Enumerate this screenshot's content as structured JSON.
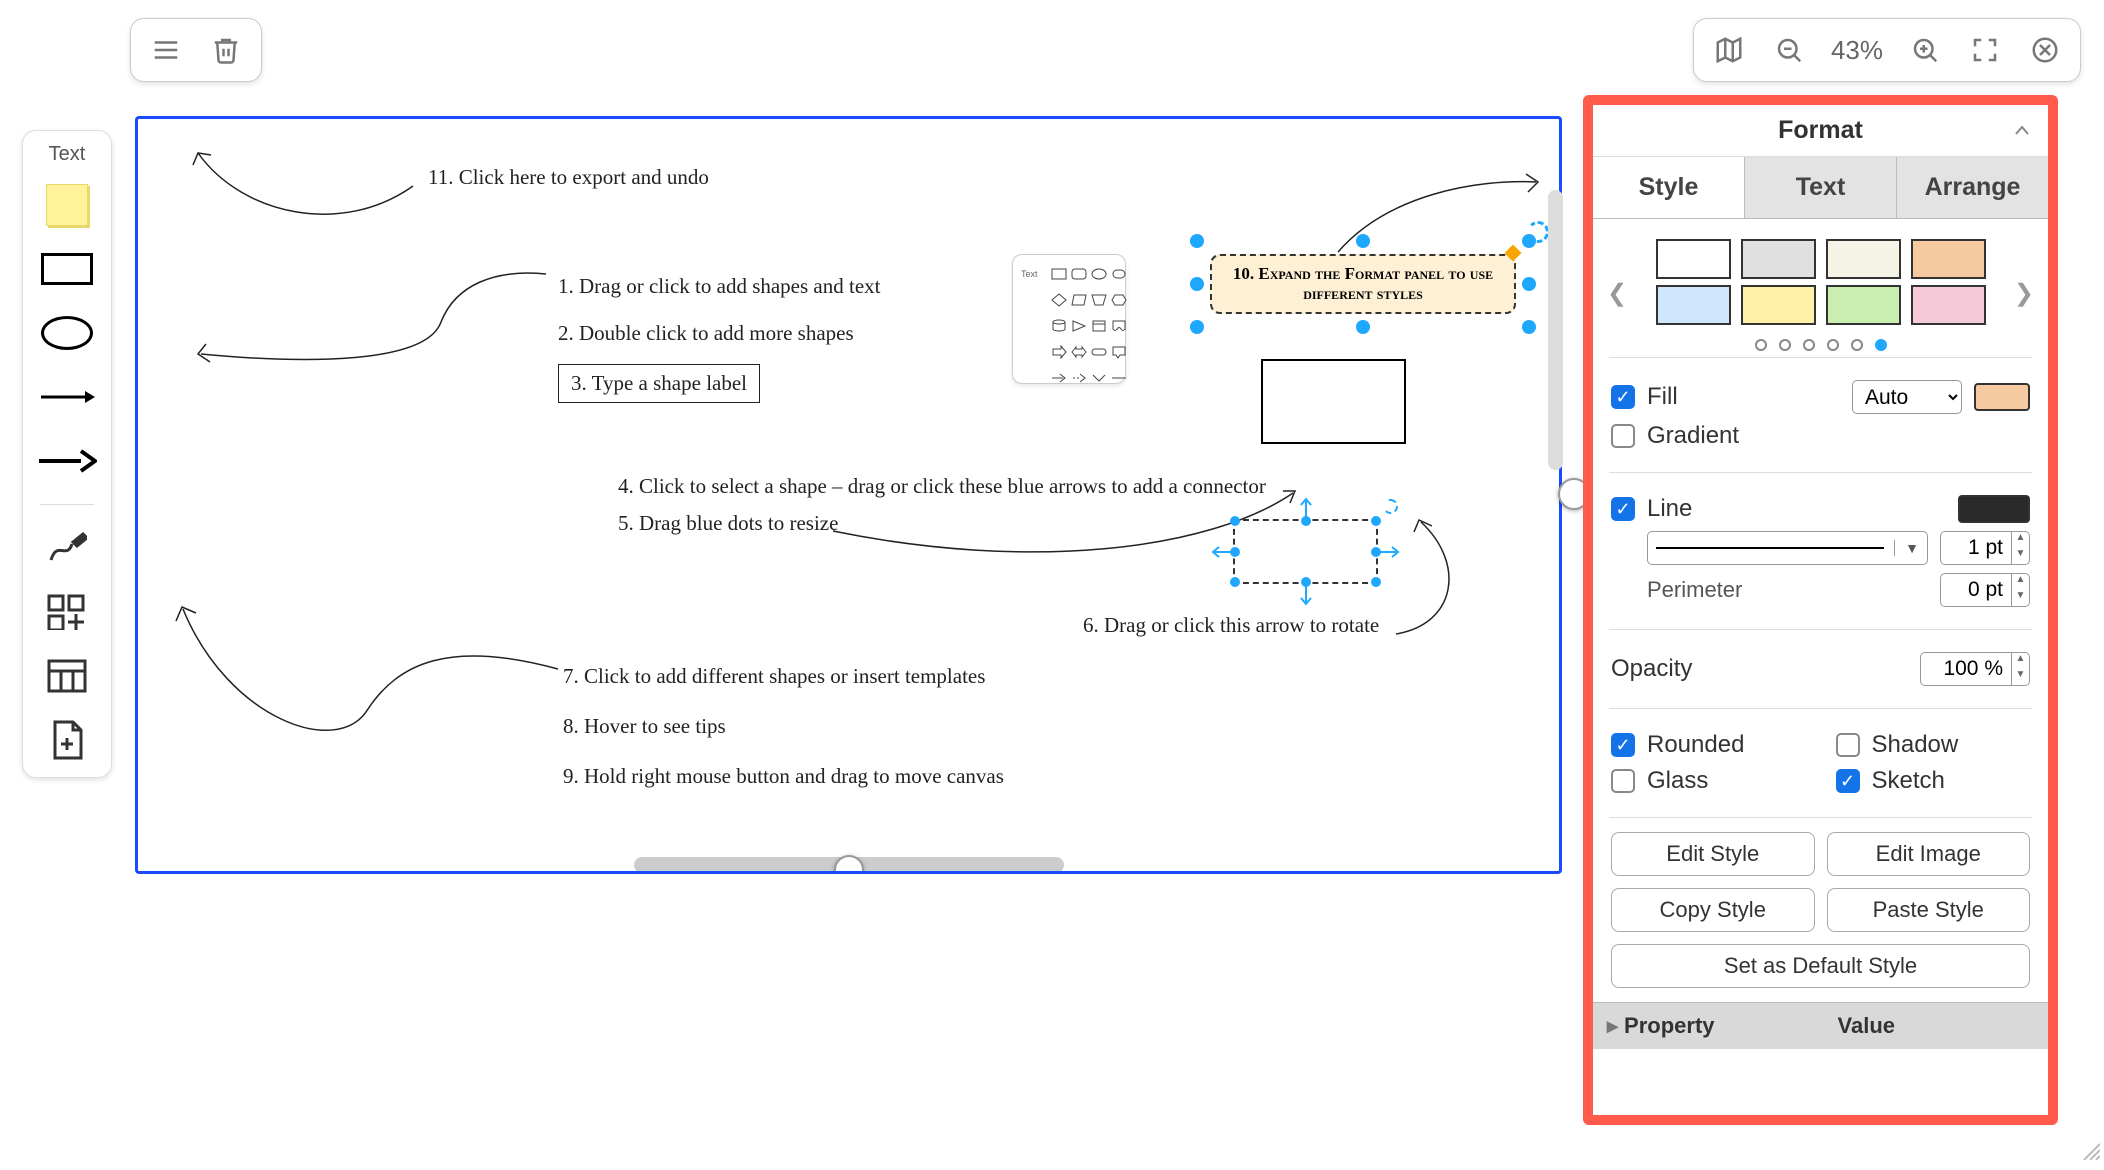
{
  "toolbar_right": {
    "zoom_label": "43%"
  },
  "palette": {
    "text_label": "Text"
  },
  "tips": {
    "t11": "11. Click here to export and undo",
    "t1": "1. Drag or click to add shapes and text",
    "t2": "2. Double click to add more shapes",
    "t3": "3. Type a shape label",
    "t4": "4. Click to select a shape – drag or click these blue arrows to add a connector",
    "t5": "5. Drag blue dots to resize",
    "t6": "6. Drag or click this arrow to rotate",
    "t7": "7. Click to add different shapes or insert templates",
    "t8": "8. Hover to see tips",
    "t9": "9. Hold right mouse button and drag to move canvas",
    "t10": "10. Expand the Format panel to use different styles",
    "picker_text": "Text"
  },
  "format": {
    "title": "Format",
    "tabs": {
      "style": "Style",
      "text": "Text",
      "arrange": "Arrange"
    },
    "swatches_row1": [
      "#ffffff",
      "#e0e0e0",
      "#f5f2e6",
      "#f6caa0"
    ],
    "swatches_row2": [
      "#cfe5fb",
      "#fff1a8",
      "#c9eeb0",
      "#f4c9d8"
    ],
    "pager_active_index": 5,
    "fill": {
      "label": "Fill",
      "checked": true,
      "mode": "Auto",
      "color": "#f6caa0",
      "gradient_label": "Gradient",
      "gradient_checked": false
    },
    "line": {
      "label": "Line",
      "checked": true,
      "width_value": "1 pt",
      "color": "#2a2a2a",
      "perimeter_label": "Perimeter",
      "perimeter_value": "0 pt"
    },
    "opacity_label": "Opacity",
    "opacity_value": "100 %",
    "flags": {
      "rounded_label": "Rounded",
      "rounded": true,
      "shadow_label": "Shadow",
      "shadow": false,
      "glass_label": "Glass",
      "glass": false,
      "sketch_label": "Sketch",
      "sketch": true
    },
    "buttons": {
      "edit_style": "Edit Style",
      "edit_image": "Edit Image",
      "copy_style": "Copy Style",
      "paste_style": "Paste Style",
      "set_default": "Set as Default Style"
    },
    "prop_table": {
      "property": "Property",
      "value": "Value"
    }
  }
}
